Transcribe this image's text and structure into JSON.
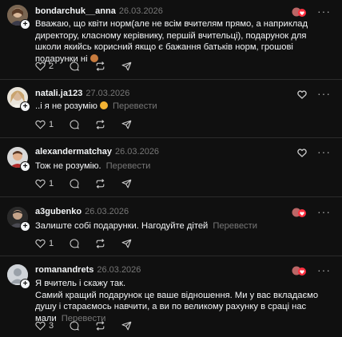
{
  "posts": [
    {
      "username": "bondarchuk__anna",
      "date": "26.03.2026",
      "text": "Вважаю, що квіти норм(але не всім вчителям прямо, а наприклад директору, класному керівнику, першій вчительці), подарунок для школи якийсь корисний якщо є бажання батьків норм, грошові подарунки ні",
      "translate": "",
      "likes": "2",
      "creator_liked": true
    },
    {
      "username": "natali.ja123",
      "date": "27.03.2026",
      "text": "..і я не розумію",
      "translate": "Перевести",
      "likes": "1",
      "creator_liked": false
    },
    {
      "username": "alexandermatchay",
      "date": "26.03.2026",
      "text": "Тож не розумію.",
      "translate": "Перевести",
      "likes": "1",
      "creator_liked": false
    },
    {
      "username": "a3gubenko",
      "date": "26.03.2026",
      "text": "Залиште собі подарунки. Нагодуйте дітей",
      "translate": "Перевести",
      "likes": "1",
      "creator_liked": true
    },
    {
      "username": "romanandrets",
      "date": "26.03.2026",
      "text_lines": [
        "Я вчитель і скажу так.",
        "Самий кращий подарунок це ваше відношення. Ми у вас вкладаємо душу і стараємось навчити, а ви по великому рахунку в сраці нас мали"
      ],
      "translate": "Перевести",
      "likes": "3",
      "creator_liked": true
    }
  ],
  "colors": {
    "background": "#101010",
    "text": "#f3f5f7",
    "muted": "#777777",
    "accent_red": "#ff3040"
  },
  "icons": [
    "heart-icon",
    "comment-icon",
    "repost-icon",
    "share-icon",
    "more-icon",
    "verified-plus-icon"
  ]
}
